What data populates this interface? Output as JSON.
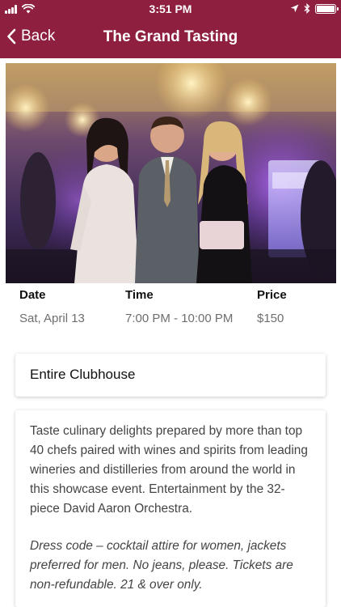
{
  "status_bar": {
    "time": "3:51 PM",
    "icons": [
      "signal-icon",
      "wifi-icon",
      "location-icon",
      "bluetooth-icon",
      "battery-icon"
    ]
  },
  "nav": {
    "back_label": "Back",
    "title": "The Grand Tasting"
  },
  "colors": {
    "brand": "#8e1f3f",
    "muted_text": "#6e6e6e",
    "body_text": "#444444"
  },
  "details": {
    "date": {
      "label": "Date",
      "value": "Sat, April 13"
    },
    "time": {
      "label": "Time",
      "value": "7:00 PM - 10:00 PM"
    },
    "price": {
      "label": "Price",
      "value": "$150"
    }
  },
  "venue": "Entire Clubhouse",
  "description": {
    "body": "Taste culinary delights prepared by more than top 40 chefs paired with wines and spirits from leading wineries and distilleries from around the world in this showcase event. Entertainment by the 32-piece David Aaron Orchestra.",
    "note": "Dress code – cocktail attire for women, jackets preferred for men. No jeans, please. Tickets are non-refundable. 21 & over only."
  }
}
